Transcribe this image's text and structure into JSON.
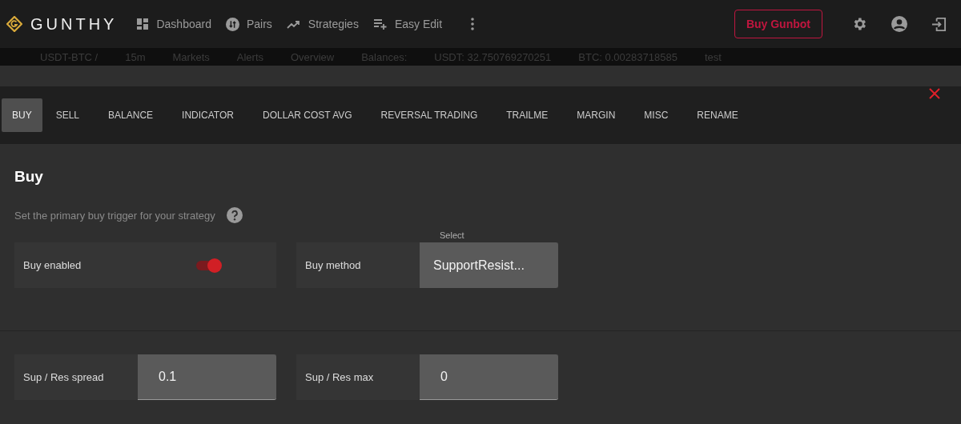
{
  "header": {
    "brand": "GUNTHY",
    "nav": [
      {
        "label": "Dashboard"
      },
      {
        "label": "Pairs"
      },
      {
        "label": "Strategies"
      },
      {
        "label": "Easy Edit"
      }
    ],
    "buy_button": "Buy Gunbot"
  },
  "ticker": [
    "USDT-BTC /",
    "15m",
    "Markets",
    "Alerts",
    "Overview",
    "Balances:",
    "USDT: 32.750769270251",
    "BTC: 0.00283718585",
    "test"
  ],
  "tabs": [
    {
      "label": "BUY",
      "selected": true
    },
    {
      "label": "SELL",
      "selected": false
    },
    {
      "label": "BALANCE",
      "selected": false
    },
    {
      "label": "INDICATOR",
      "selected": false
    },
    {
      "label": "DOLLAR COST AVG",
      "selected": false
    },
    {
      "label": "REVERSAL TRADING",
      "selected": false
    },
    {
      "label": "TRAILME",
      "selected": false
    },
    {
      "label": "MARGIN",
      "selected": false
    },
    {
      "label": "MISC",
      "selected": false
    },
    {
      "label": "RENAME",
      "selected": false
    }
  ],
  "section": {
    "title": "Buy",
    "description": "Set the primary buy trigger for your strategy"
  },
  "field_rows": [
    [
      {
        "kind": "toggle",
        "label": "Buy enabled",
        "on": true
      },
      {
        "kind": "select",
        "label": "Buy method",
        "floating_label": "Select",
        "value": "SupportResist..."
      }
    ],
    [
      {
        "kind": "input",
        "label": "Sup / Res spread",
        "value": "0.1"
      },
      {
        "kind": "input",
        "label": "Sup / Res max",
        "value": "0"
      }
    ]
  ]
}
